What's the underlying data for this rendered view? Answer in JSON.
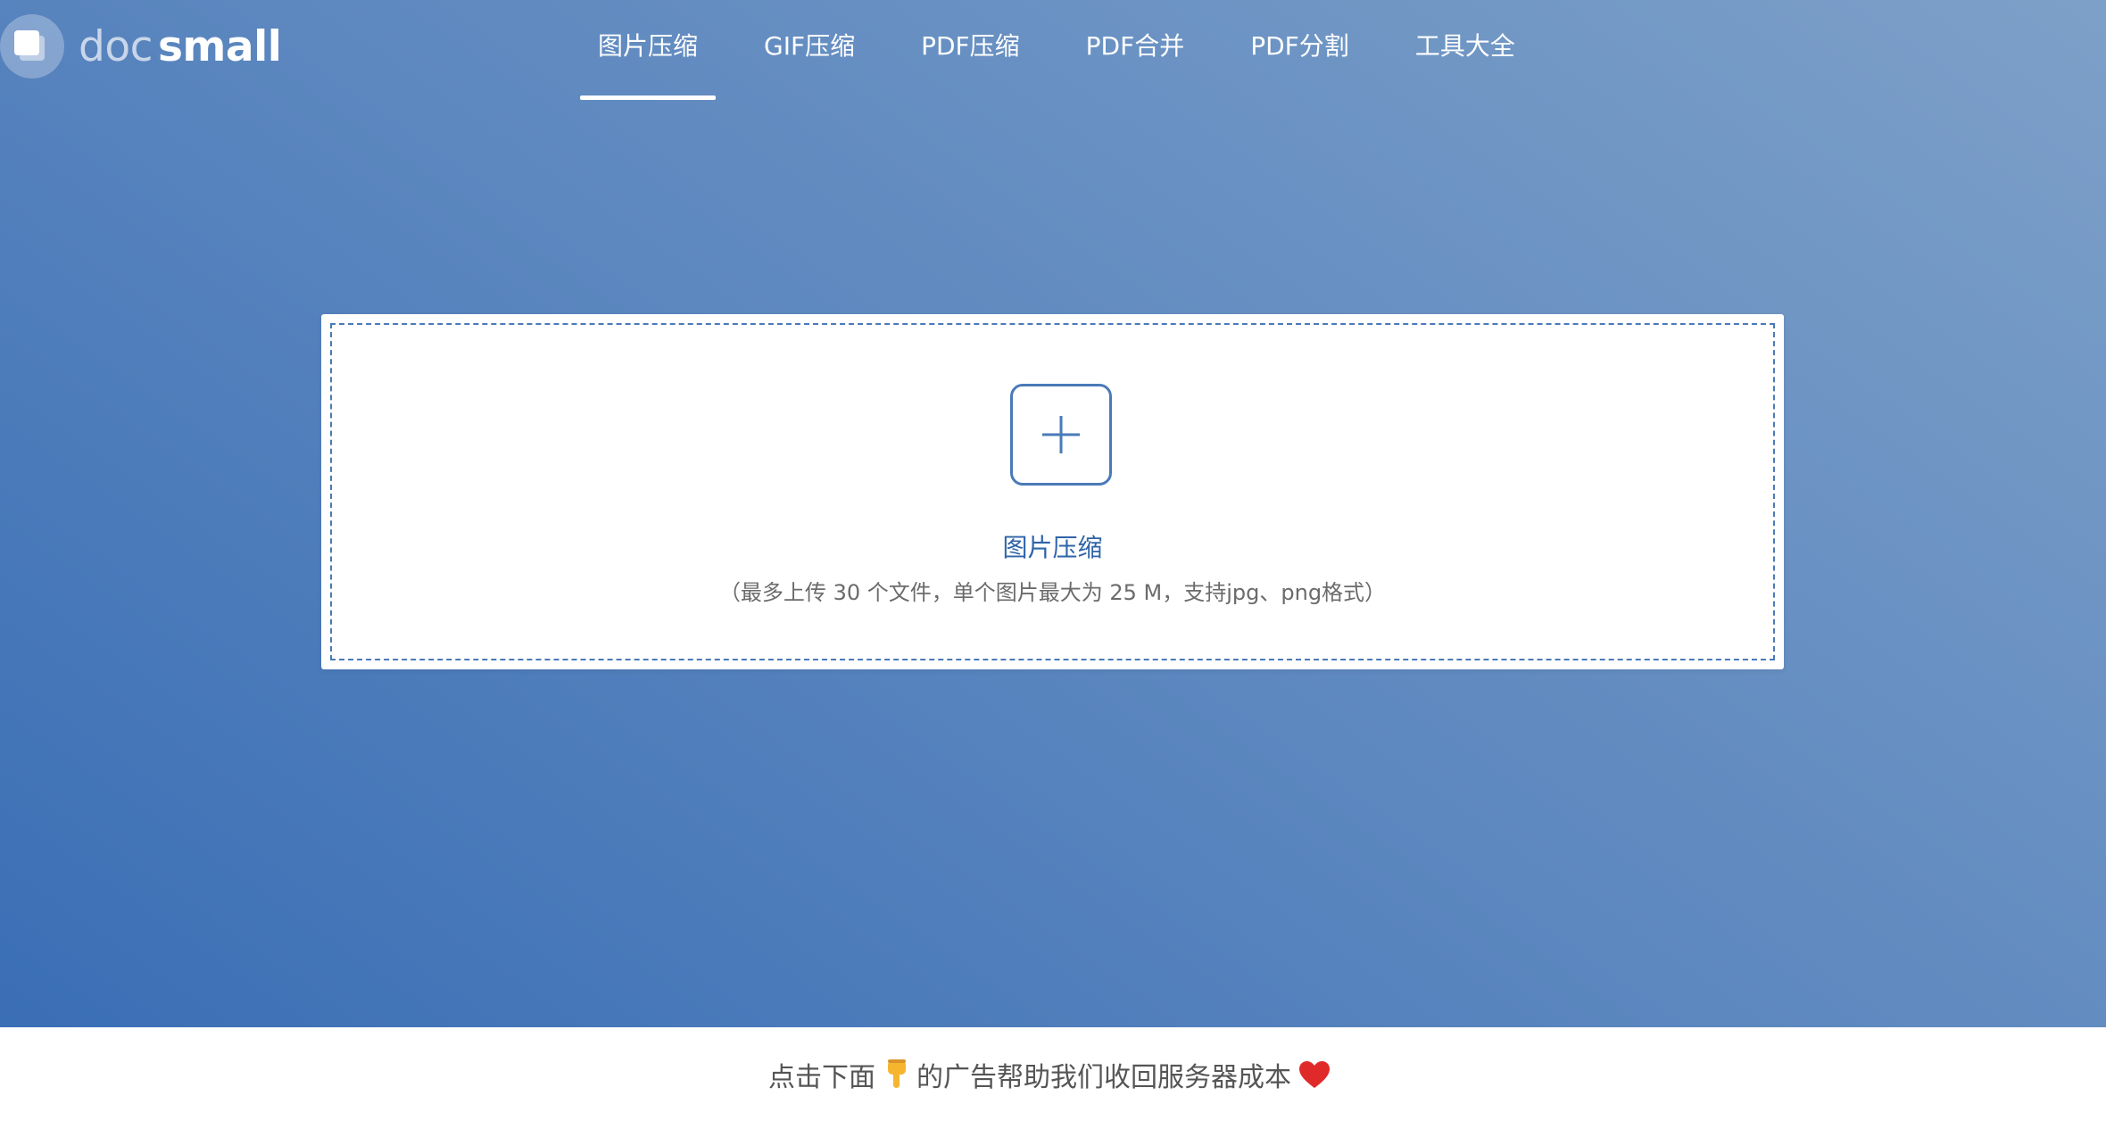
{
  "brand": {
    "logo_doc": "doc",
    "logo_small": "small"
  },
  "nav": {
    "tabs": [
      {
        "label": "图片压缩",
        "active": true
      },
      {
        "label": "GIF压缩",
        "active": false
      },
      {
        "label": "PDF压缩",
        "active": false
      },
      {
        "label": "PDF合并",
        "active": false
      },
      {
        "label": "PDF分割",
        "active": false
      },
      {
        "label": "工具大全",
        "active": false
      }
    ]
  },
  "upload": {
    "title": "图片压缩",
    "hint": "（最多上传 30 个文件，单个图片最大为 25 M，支持jpg、png格式）"
  },
  "footer": {
    "text_before": "点击下面",
    "text_after": "的广告帮助我们收回服务器成本"
  },
  "icons": {
    "logo": "docsmall-logo-icon",
    "add": "plus-icon",
    "pointer": "pointing-down-emoji",
    "heart": "red-heart-emoji"
  },
  "colors": {
    "accent": "#4a7ab8",
    "title": "#2f64a8",
    "gradient_start": "#3a6eb5",
    "gradient_end": "#7da0c8",
    "heart": "#e02a2a"
  }
}
